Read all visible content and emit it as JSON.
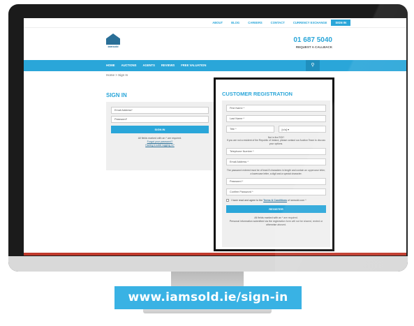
{
  "topnav": {
    "items": [
      "ABOUT",
      "BLOG",
      "CAREERS",
      "CONTACT",
      "CURRENCY EXCHANGE",
      "SIGN IN"
    ]
  },
  "logo": {
    "text": "iamsold"
  },
  "header": {
    "phone": "01 687 5040",
    "callback": "REQUEST A CALLBACK"
  },
  "navbar": {
    "items": [
      "HOME",
      "AUCTIONS",
      "AGENTS",
      "REVIEWS",
      "FREE VALUATION"
    ]
  },
  "breadcrumb": "Home > Sign In",
  "signin": {
    "title": "SIGN IN",
    "email_placeholder": "Email Address*",
    "password_placeholder": "Password*",
    "button": "SIGN IN",
    "required_note": "All fields marked with an * are required.",
    "forgot": "Forgot your password?",
    "trouble": "Having trouble logging in?"
  },
  "registration": {
    "title": "CUSTOMER REGISTRATION",
    "first_name": "First Name *",
    "last_name": "Last Name *",
    "title_field": "Title *",
    "title_value": "[n/a] ▾",
    "roi_note": "Not in the ROI?",
    "roi_note2": "If you are not a resident of the Republic of Ireland, please contact our Auction Team to discuss your options.",
    "telephone": "Telephone Number *",
    "email": "Email Address *",
    "password_note": "The password entered must be of least 8 characters in length and contain an uppercase letter, a lowercase letter, a digit and a special character.",
    "password": "Password *",
    "confirm_password": "Confirm Password *",
    "terms_prefix": "I have read and agree to the",
    "terms_link": "Terms & Conditions",
    "terms_suffix": "of iamsold.com *",
    "button": "REGISTER",
    "required_note": "All fields marked with an * are required.",
    "privacy_note": "Personal information submitted via the registration form will not be shared, rented or otherwise abused."
  },
  "banner": "www.iamsold.ie/sign-in"
}
